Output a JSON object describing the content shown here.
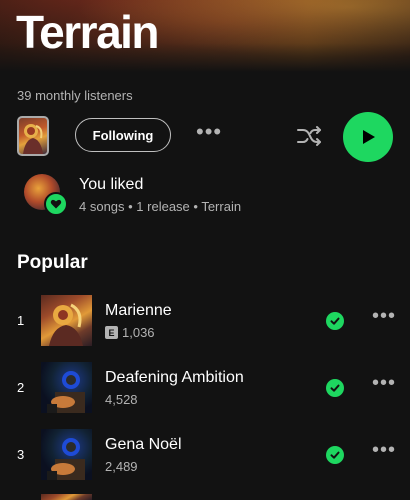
{
  "artist": {
    "name": "Terrain",
    "monthly_listeners": "39 monthly listeners"
  },
  "controls": {
    "follow_label": "Following",
    "more_label": "•••"
  },
  "liked": {
    "title": "You liked",
    "subtitle": "4 songs • 1 release • Terrain"
  },
  "popular": {
    "title": "Popular",
    "tracks": [
      {
        "number": "1",
        "title": "Marienne",
        "explicit": "E",
        "plays": "1,036"
      },
      {
        "number": "2",
        "title": "Deafening Ambition",
        "plays": "4,528"
      },
      {
        "number": "3",
        "title": "Gena Noël",
        "plays": "2,489"
      }
    ]
  },
  "colors": {
    "accent": "#1ed760",
    "background": "#121212",
    "secondary_text": "#b3b3b3"
  }
}
